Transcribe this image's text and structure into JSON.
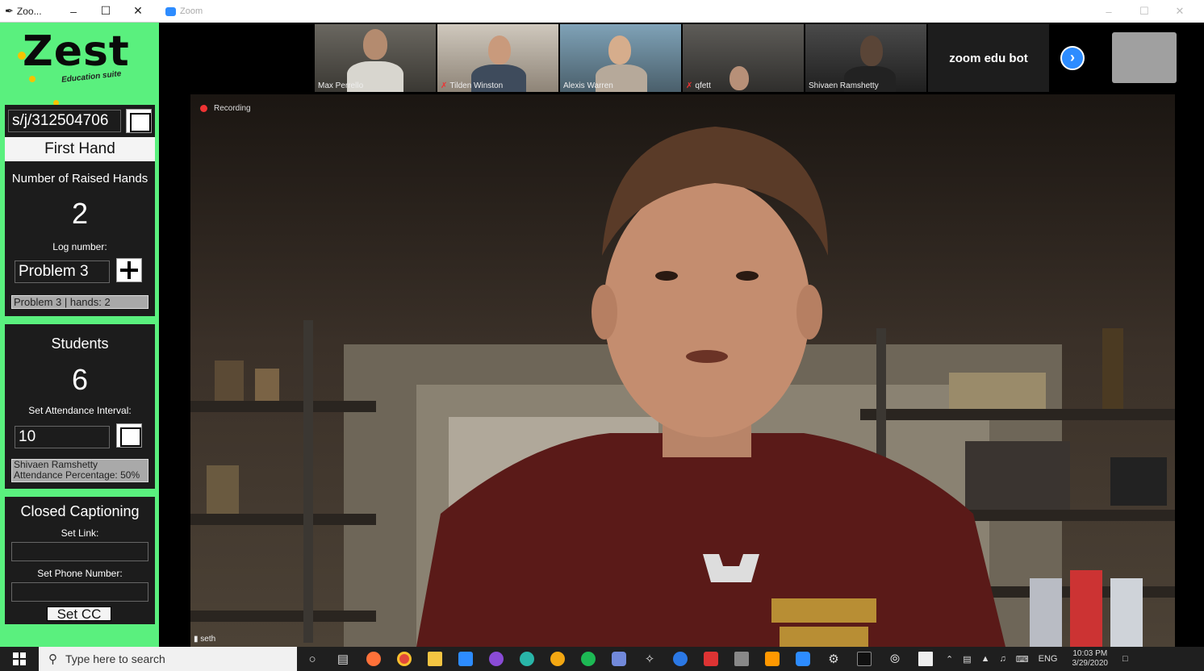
{
  "zest": {
    "window_title": "Zoo...",
    "logo_word": "Zest",
    "logo_sub": "Education suite",
    "meeting_link": "s/j/312504706",
    "first_hand_button": "First Hand",
    "raised_hands_label": "Number of Raised Hands",
    "raised_hands_count": "2",
    "log_number_label": "Log number:",
    "log_number_value": "Problem 3",
    "log_readout": "Problem 3 | hands: 2",
    "students_label": "Students",
    "students_count": "6",
    "attendance_label": "Set Attendance Interval:",
    "attendance_value": "10",
    "attendance_readout_line1": "Shivaen Ramshetty",
    "attendance_readout_line2": "Attendance Percentage: 50%",
    "cc_title": "Closed Captioning",
    "cc_link_label": "Set Link:",
    "cc_phone_label": "Set Phone Number:",
    "cc_link_value": "",
    "cc_phone_value": "",
    "set_cc_button": "Set CC"
  },
  "zoom": {
    "window_title": "Zoom",
    "participants": [
      {
        "name": "Max Perrello",
        "muted": false
      },
      {
        "name": "Tilden Winston",
        "muted": true
      },
      {
        "name": "Alexis Warren",
        "muted": false
      },
      {
        "name": "qfett",
        "muted": true
      },
      {
        "name": "Shivaen Ramshetty",
        "muted": false
      }
    ],
    "bot_name": "zoom edu bot",
    "recording_label": "Recording",
    "active_speaker": "seth"
  },
  "taskbar": {
    "search_placeholder": "Type here to search",
    "language": "ENG",
    "time": "10:03 PM",
    "date": "3/29/2020"
  },
  "colors": {
    "zest_green": "#5af07e",
    "zoom_blue": "#2d8cff",
    "recording_red": "#e33333"
  }
}
